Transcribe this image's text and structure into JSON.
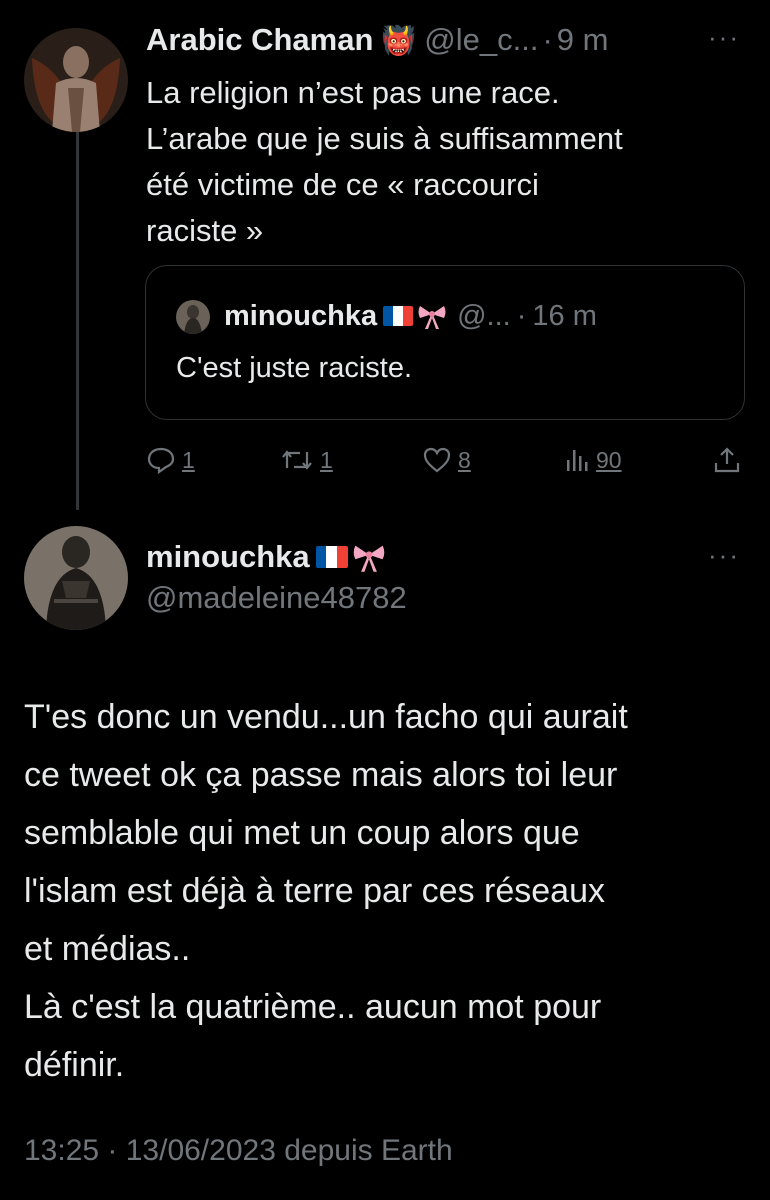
{
  "tweet1": {
    "author_name": "Arabic Chaman",
    "author_emoji": "👹",
    "handle": "@le_c...",
    "dot": "·",
    "time": "9 m",
    "more": "···",
    "body_lines": [
      "La religion n’est pas une race.",
      "L’arabe que je suis à suffisamment",
      "été victime de ce « raccourci",
      "raciste »"
    ],
    "quote": {
      "author_name": "minouchka",
      "handle": "@...",
      "dot": "·",
      "time": "16 m",
      "text": "C'est juste raciste."
    },
    "actions": {
      "replies": "1",
      "retweets": "1",
      "likes": "8",
      "views": "90"
    }
  },
  "tweet2": {
    "author_name": "minouchka",
    "handle": "@madeleine48782",
    "more": "···",
    "body_lines": [
      "T'es donc un vendu...un facho qui aurait",
      "ce tweet ok ça passe mais alors toi leur",
      "semblable qui met un coup alors que",
      "l'islam est déjà à terre par ces réseaux",
      "et médias..",
      "Là c'est la quatrième.. aucun mot pour",
      "définir."
    ],
    "footer": "13:25 · 13/06/2023 depuis Earth"
  },
  "colors": {
    "background": "#000000",
    "text": "#e7e9ea",
    "muted": "#71767b",
    "border": "#2f3336"
  }
}
